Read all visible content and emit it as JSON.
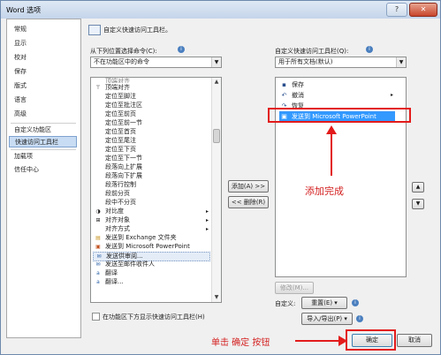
{
  "window": {
    "title": "Word 选项",
    "help_glyph": "?",
    "close_glyph": "✕"
  },
  "sidebar": {
    "items": [
      {
        "label": "常规"
      },
      {
        "label": "显示"
      },
      {
        "label": "校对"
      },
      {
        "label": "保存"
      },
      {
        "label": "版式"
      },
      {
        "label": "语言"
      },
      {
        "label": "高级"
      },
      {
        "label": "自定义功能区"
      },
      {
        "label": "快速访问工具栏",
        "selected": true
      },
      {
        "label": "加载项"
      },
      {
        "label": "信任中心"
      }
    ]
  },
  "header": {
    "title": "自定义快速访问工具栏。"
  },
  "left": {
    "choose_label": "从下列位置选择命令(C):",
    "choose_value": "不在功能区中的命令",
    "commands": [
      {
        "label": "顶端对齐",
        "icon": "align-top-icon"
      },
      {
        "label": "定位至脚注",
        "icon": ""
      },
      {
        "label": "定位至批注区",
        "icon": ""
      },
      {
        "label": "定位至前页",
        "icon": ""
      },
      {
        "label": "定位至前一节",
        "icon": ""
      },
      {
        "label": "定位至首页",
        "icon": ""
      },
      {
        "label": "定位至尾注",
        "icon": ""
      },
      {
        "label": "定位至下页",
        "icon": ""
      },
      {
        "label": "定位至下一节",
        "icon": ""
      },
      {
        "label": "段落向上扩展",
        "icon": ""
      },
      {
        "label": "段落向下扩展",
        "icon": ""
      },
      {
        "label": "段落行控制",
        "icon": ""
      },
      {
        "label": "段前分页",
        "icon": ""
      },
      {
        "label": "段中不分页",
        "icon": ""
      },
      {
        "label": "对比度",
        "icon": "contrast-icon",
        "submenu": true
      },
      {
        "label": "对齐对象",
        "icon": "align-objects-icon",
        "submenu": true
      },
      {
        "label": "对齐方式",
        "icon": "",
        "submenu": true
      },
      {
        "label": "发送到 Exchange 文件夹",
        "icon": "exchange-icon"
      },
      {
        "label": "发送到 Microsoft PowerPoint",
        "icon": "powerpoint-icon"
      },
      {
        "label": "发送供审阅...",
        "icon": "review-icon",
        "highlighted": true
      },
      {
        "label": "发送至邮件收件人",
        "icon": "mail-icon"
      },
      {
        "label": "翻译",
        "icon": "translate-icon"
      },
      {
        "label": "翻译...",
        "icon": "translate-icon"
      }
    ],
    "show_below_label": "在功能区下方显示快速访问工具栏(H)"
  },
  "middle": {
    "add_label": "添加(A) >>",
    "remove_label": "<< 删除(R)"
  },
  "right": {
    "customize_label": "自定义快速访问工具栏(Q):",
    "customize_value": "用于所有文档(默认)",
    "items": [
      {
        "label": "保存",
        "icon": "save-icon"
      },
      {
        "label": "撤消",
        "icon": "undo-icon",
        "submenu": true
      },
      {
        "label": "恢复",
        "icon": "redo-icon"
      },
      {
        "label": "发送到 Microsoft PowerPoint",
        "icon": "powerpoint-icon",
        "selected": true
      }
    ],
    "modify_label": "修改(M)...",
    "customize_row_label": "自定义:",
    "reset_label": "重置(E) ▾",
    "import_export_label": "导入/导出(P) ▾",
    "info_glyph": "i",
    "up_glyph": "▲",
    "down_glyph": "▼"
  },
  "annotations": {
    "added": "添加完成",
    "click_ok": "单击  确定  按钮"
  },
  "footer": {
    "ok_label": "确定",
    "cancel_label": "取消"
  },
  "colors": {
    "selection": "#3399ff",
    "annotation": "#e31b1b"
  }
}
